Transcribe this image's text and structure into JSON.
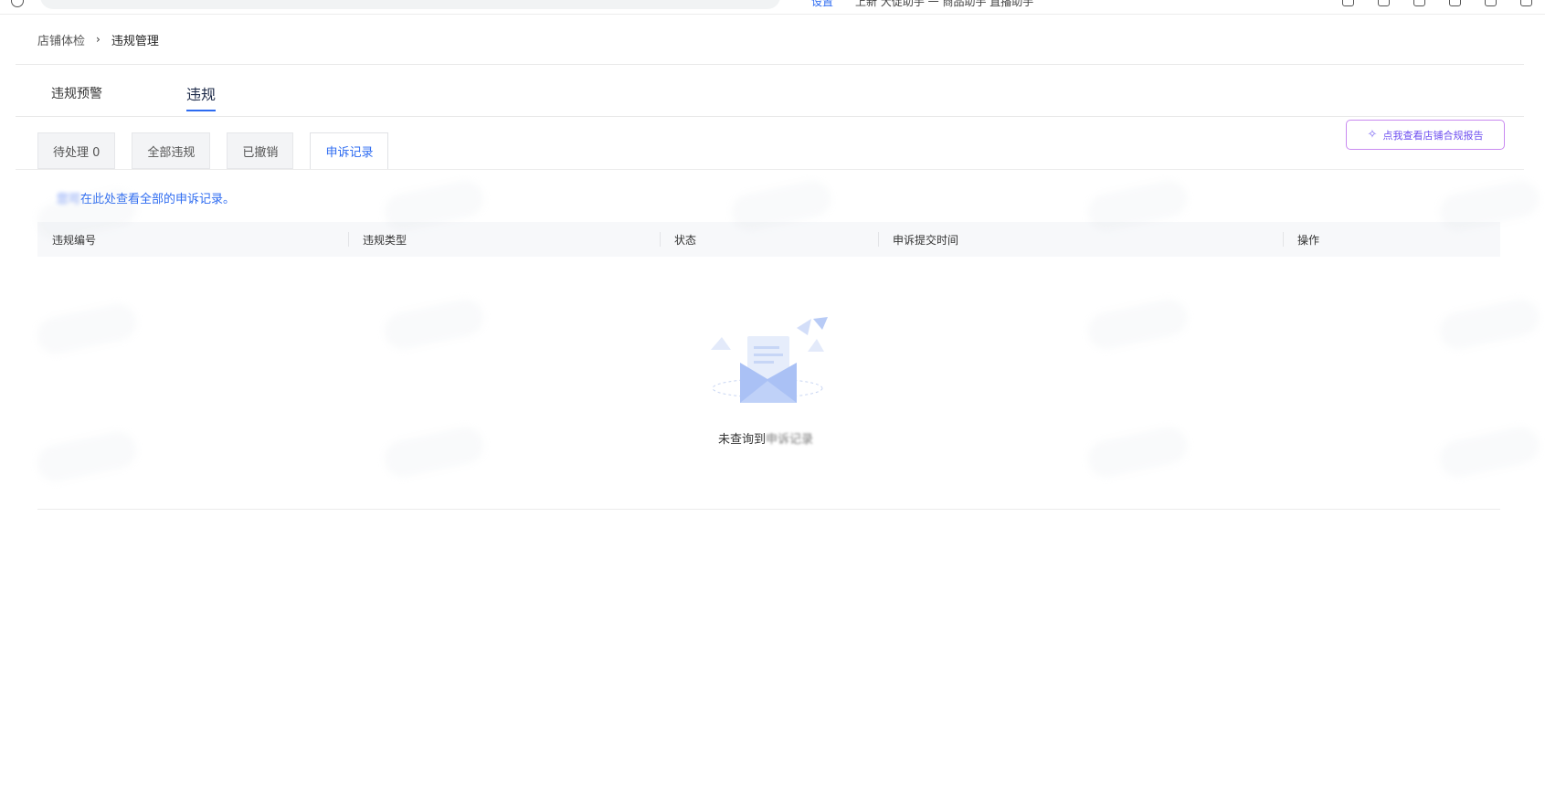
{
  "browser": {
    "link_fragment": "设置",
    "toolbar_text": "上新 大促助手   一   商品助手  直播助手"
  },
  "breadcrumb": {
    "parent": "店铺体检",
    "separator": "›",
    "current": "违规管理"
  },
  "main_tabs": [
    {
      "label": "违规预警"
    },
    {
      "label": "违规"
    }
  ],
  "sub_tabs": [
    {
      "label": "待处理 0"
    },
    {
      "label": "全部违规"
    },
    {
      "label": "已撤销"
    },
    {
      "label": "申诉记录"
    }
  ],
  "report_button": {
    "icon": "sparkle-icon",
    "label": "点我查看店铺合规报告"
  },
  "notice": {
    "prefix": "您可",
    "text": "在此处查看全部的申诉记录。"
  },
  "table": {
    "columns": [
      "违规编号",
      "违规类型",
      "状态",
      "申诉提交时间",
      "操作"
    ]
  },
  "empty_state": {
    "icon": "empty-envelope-icon",
    "text_main": "未查询到",
    "text_faded": "申诉记录"
  },
  "colors": {
    "accent": "#2d6bf1",
    "report_border": "#c98af0",
    "report_text": "#6e4ff0"
  }
}
